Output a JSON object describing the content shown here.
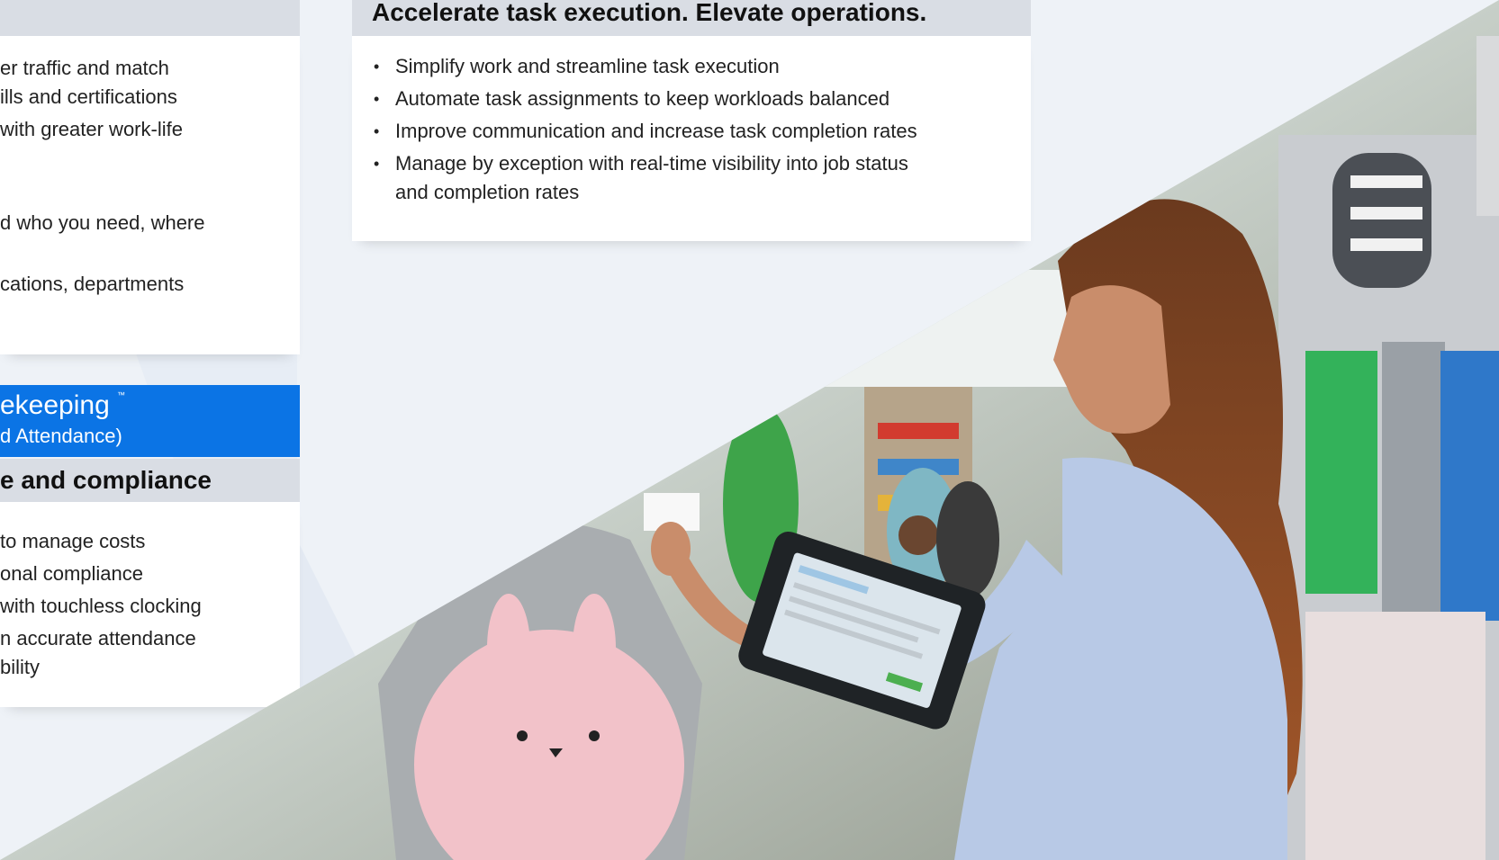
{
  "left_panel": {
    "lines": [
      "er traffic and match",
      "ills and certifications",
      " with greater work-life",
      "d who you need, where",
      "cations, departments"
    ]
  },
  "timekeeping": {
    "title": "ekeeping",
    "tm": "™",
    "subtitle": "d Attendance)",
    "heading": "e and compliance",
    "lines": [
      " to manage costs",
      "onal compliance",
      " with touchless clocking",
      "n accurate attendance",
      "bility"
    ]
  },
  "task_panel": {
    "heading": "Accelerate task execution. Elevate operations.",
    "bullets": [
      "Simplify work and streamline task execution",
      "Automate task assignments to keep workloads balanced",
      "Improve communication and increase task completion rates",
      "Manage by exception with real-time visibility into job status",
      "and completion rates"
    ]
  },
  "colors": {
    "accent_blue": "#0b74e5",
    "header_gray": "#d9dde4"
  },
  "photo": {
    "subject": "retail-worker-with-rugged-tablet-photo"
  }
}
